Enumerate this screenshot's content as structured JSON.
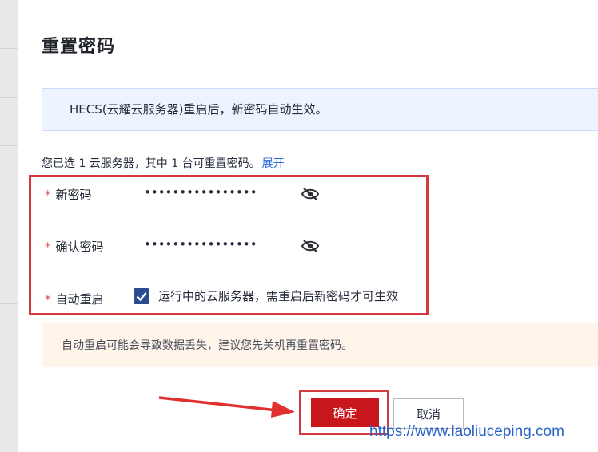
{
  "dialog": {
    "title": "重置密码",
    "info": "HECS(云耀云服务器)重启后，新密码自动生效。",
    "summary_text": "您已选 1 云服务器，其中 1 台可重置密码。",
    "summary_link": "展开"
  },
  "form": {
    "new_password": {
      "label": "新密码",
      "value": "••••••••••••••••"
    },
    "confirm_password": {
      "label": "确认密码",
      "value": "••••••••••••••••"
    },
    "auto_restart": {
      "label": "自动重启",
      "checked": true,
      "text": "运行中的云服务器，需重启后新密码才可生效"
    },
    "required_mark": "*"
  },
  "warning": "自动重启可能会导致数据丢失，建议您先关机再重置密码。",
  "buttons": {
    "confirm": "确定",
    "cancel": "取消"
  },
  "icons": {
    "password_toggle": "eye-slash-icon",
    "checkbox": "check-icon",
    "annotation": "arrow-icon"
  },
  "colors": {
    "primary": "#c8161d",
    "link": "#2e6bd8",
    "highlight": "#d53a3f",
    "checkbox": "#2b4c8f"
  },
  "watermark": "https://www.laoliuceping.com"
}
